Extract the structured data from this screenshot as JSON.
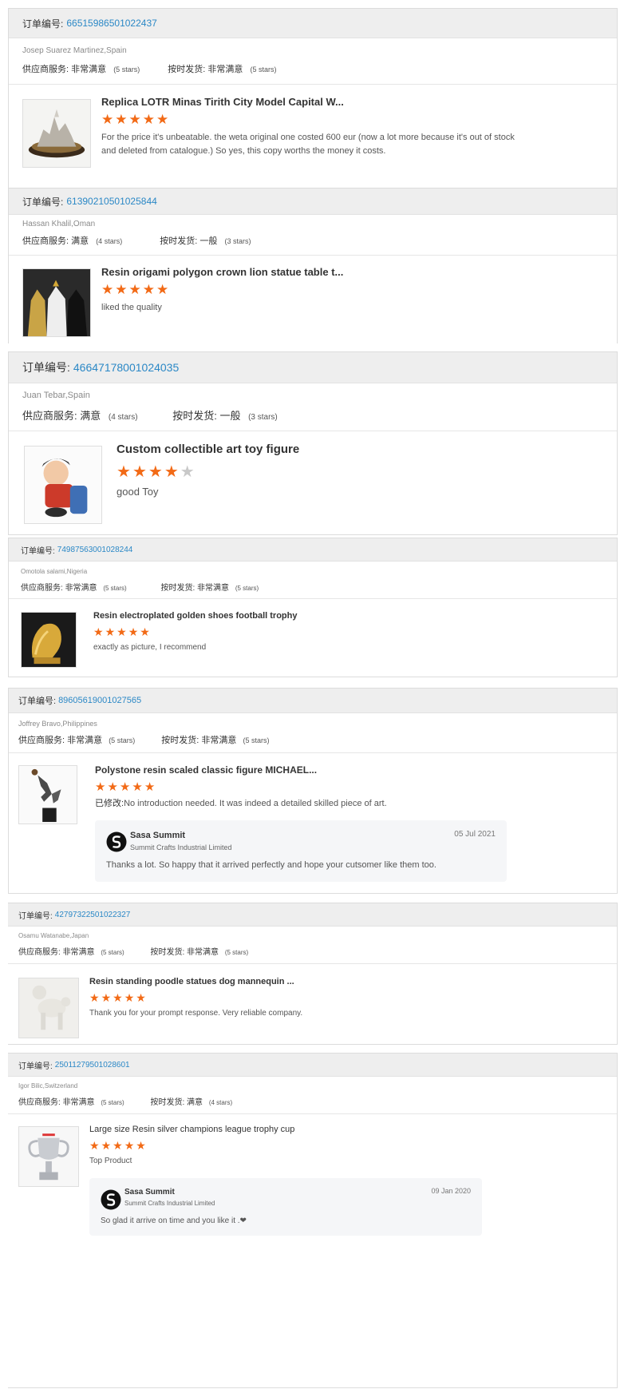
{
  "common": {
    "order_label": "订单编号:",
    "supplier_label": "供应商服务:",
    "delivery_label": "按时发货:"
  },
  "reviews": [
    {
      "order_no": "66515986501022437",
      "buyer": "Josep Suarez Martinez,Spain",
      "supplier_rating": "非常满意",
      "supplier_stars": "(5 stars)",
      "delivery_rating": "非常满意",
      "delivery_stars": "(5 stars)",
      "product_title": "Replica LOTR Minas Tirith City Model Capital W...",
      "stars": 5,
      "comment": "For the price it's unbeatable. the weta original one costed 600 eur (now a lot more because it's out of stock and deleted from catalogue.) So yes, this copy worths the money it costs.",
      "thumb_icon": "castle-model-image"
    },
    {
      "order_no": "61390210501025844",
      "buyer": "Hassan Khalil,Oman",
      "supplier_rating": "满意",
      "supplier_stars": "(4 stars)",
      "delivery_rating": "一般",
      "delivery_stars": "(3 stars)",
      "product_title": "Resin origami polygon crown lion statue table t...",
      "stars": 5,
      "comment": "liked the quality",
      "thumb_icon": "lion-statues-image"
    },
    {
      "order_no": "46647178001024035",
      "buyer": "Juan Tebar,Spain",
      "supplier_rating": "满意",
      "supplier_stars": "(4 stars)",
      "delivery_rating": "一般",
      "delivery_stars": "(3 stars)",
      "product_title": "Custom collectible art toy figure",
      "stars": 4,
      "comment": "good Toy",
      "thumb_icon": "toy-figure-image"
    },
    {
      "order_no": "74987563001028244",
      "buyer": "Omotola salami,Nigeria",
      "supplier_rating": "非常满意",
      "supplier_stars": "(5 stars)",
      "delivery_rating": "非常满意",
      "delivery_stars": "(5 stars)",
      "product_title": "Resin electroplated golden shoes football trophy",
      "stars": 5,
      "comment": "exactly as picture, I recommend",
      "thumb_icon": "golden-shoe-image"
    },
    {
      "order_no": "89605619001027565",
      "buyer": "Joffrey Bravo,Philippines",
      "supplier_rating": "非常满意",
      "supplier_stars": "(5 stars)",
      "delivery_rating": "非常满意",
      "delivery_stars": "(5 stars)",
      "product_title": "Polystone resin scaled classic figure MICHAEL...",
      "stars": 5,
      "modified_label": "已修改:",
      "comment": "No introduction needed. It was indeed a detailed skilled piece of art.",
      "thumb_icon": "basketball-figure-image",
      "reply": {
        "name": "Sasa Summit",
        "company": "Summit Crafts Industrial Limited",
        "date": "05 Jul 2021",
        "text": "Thanks a lot. So happy that it arrived perfectly and hope your cutsomer like them too."
      }
    },
    {
      "order_no": "42797322501022327",
      "buyer": "Osamu Watanabe,Japan",
      "supplier_rating": "非常满意",
      "supplier_stars": "(5 stars)",
      "delivery_rating": "非常满意",
      "delivery_stars": "(5 stars)",
      "product_title": "Resin standing poodle statues dog mannequin ...",
      "stars": 5,
      "comment": "Thank you for your prompt response. Very reliable company.",
      "thumb_icon": "poodle-statue-image"
    },
    {
      "order_no": "25011279501028601",
      "buyer": "Igor Bilic,Switzerland",
      "supplier_rating": "非常满意",
      "supplier_stars": "(5 stars)",
      "delivery_rating": "满意",
      "delivery_stars": "(4 stars)",
      "product_title": "Large size Resin silver champions league trophy cup",
      "stars": 5,
      "comment": "Top Product",
      "thumb_icon": "trophy-cup-image",
      "reply": {
        "name": "Sasa Summit",
        "company": "Summit Crafts Industrial Limited",
        "date": "09 Jan 2020",
        "text": "So glad it arrive on time and you like it .❤"
      }
    }
  ]
}
